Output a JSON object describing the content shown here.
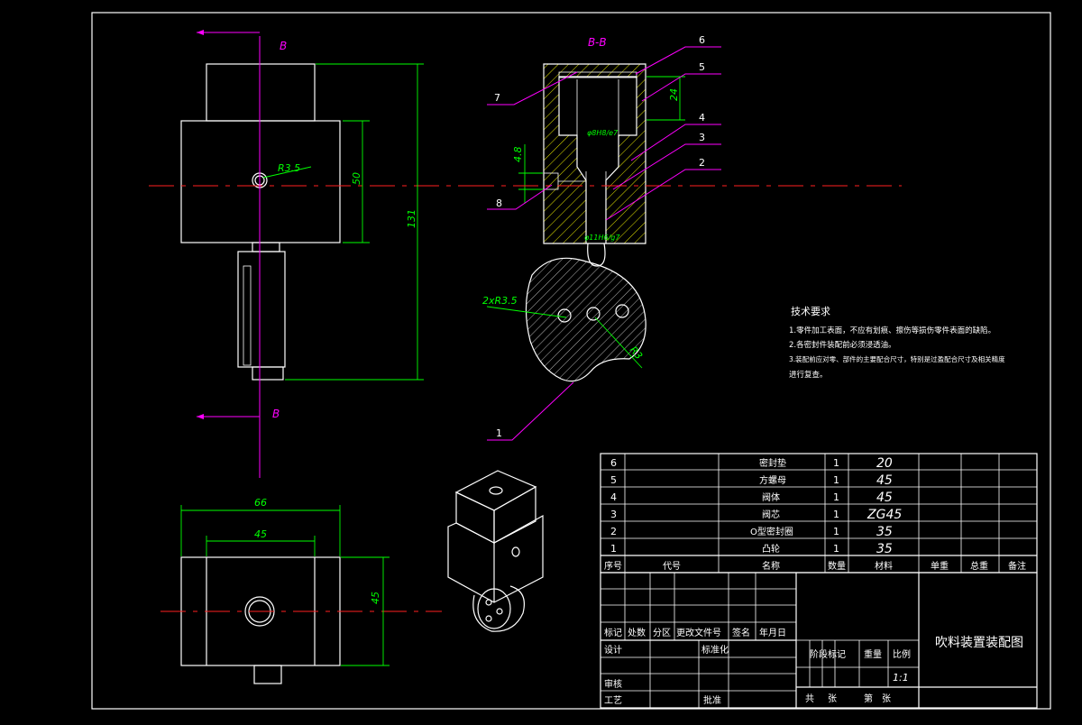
{
  "drawing": {
    "title": "吹料装置装配图",
    "section_label": "B-B",
    "cut_label_top": "B",
    "cut_label_bottom": "B"
  },
  "dimensions": {
    "r35": "R3.5",
    "d50": "50",
    "d131": "131",
    "d66": "66",
    "d45_h": "45",
    "d45_v": "45",
    "d24": "24",
    "d48": "4.8",
    "fit1": "φ8H8/e7",
    "fit2": "φ11H6/g7",
    "cam_holes": "2xR3.5",
    "cam_r3": "R3"
  },
  "balloons": [
    "7",
    "6",
    "5",
    "4",
    "3",
    "2",
    "8",
    "1"
  ],
  "tech_requirements": {
    "heading": "技术要求",
    "items": [
      "1.零件加工表面，不应有划痕、擦伤等损伤零件表面的缺陷。",
      "2.各密封件装配前必须浸透油。",
      "3.装配前应对零、部件的主要配合尺寸，特别是过盈配合尺寸及相关精度",
      "进行复查。"
    ]
  },
  "bom": {
    "rows": [
      {
        "no": "6",
        "code": "",
        "name": "密封垫",
        "qty": "1",
        "material": "20"
      },
      {
        "no": "5",
        "code": "",
        "name": "方螺母",
        "qty": "1",
        "material": "45"
      },
      {
        "no": "4",
        "code": "",
        "name": "阀体",
        "qty": "1",
        "material": "45"
      },
      {
        "no": "3",
        "code": "",
        "name": "阀芯",
        "qty": "1",
        "material": "ZG45"
      },
      {
        "no": "2",
        "code": "",
        "name": "O型密封圈",
        "qty": "1",
        "material": "35"
      },
      {
        "no": "1",
        "code": "",
        "name": "凸轮",
        "qty": "1",
        "material": "35"
      }
    ],
    "headers": {
      "no": "序号",
      "code": "代号",
      "name": "名称",
      "qty": "数量",
      "material": "材料",
      "unit_weight": "单重",
      "total_weight": "总重",
      "remark": "备注"
    }
  },
  "title_block": {
    "mark": "标记",
    "count": "处数",
    "zone": "分区",
    "change_doc": "更改文件号",
    "sign": "签名",
    "date": "年月日",
    "design": "设计",
    "standard": "标准化",
    "stage_mark": "阶段标记",
    "weight": "重量",
    "scale_label": "比例",
    "scale": "1:1",
    "review": "审核",
    "process": "工艺",
    "approve": "批准",
    "total": "共",
    "sheets": "张",
    "sheet_no": "第",
    "sheet": "张"
  }
}
